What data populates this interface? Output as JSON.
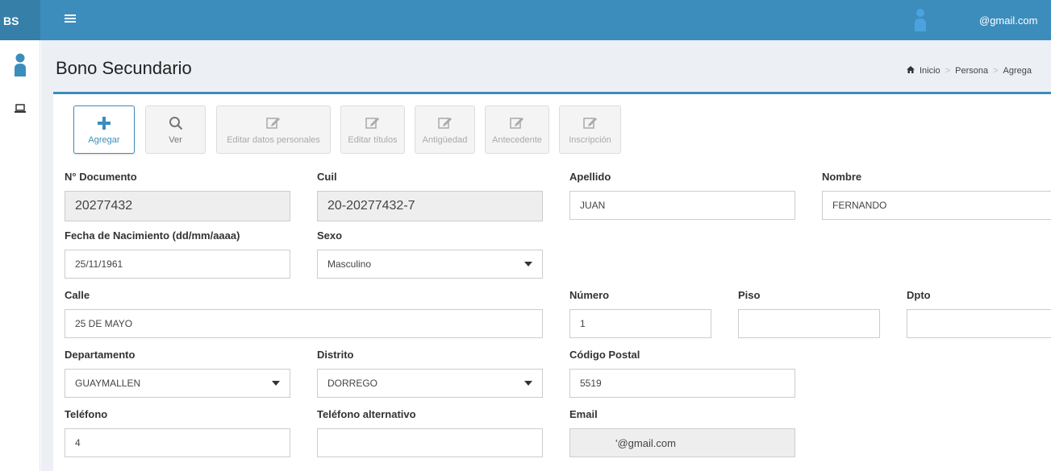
{
  "app": {
    "brand": "BS",
    "user_email": "@gmail.com"
  },
  "page": {
    "title": "Bono Secundario"
  },
  "breadcrumb": {
    "home": "Inicio",
    "item2": "Persona",
    "item3": "Agrega"
  },
  "toolbar": [
    {
      "label": "Agregar",
      "icon": "plus-icon"
    },
    {
      "label": "Ver",
      "icon": "search-icon"
    },
    {
      "label": "Editar datos personales",
      "icon": "edit-icon"
    },
    {
      "label": "Editar títulos",
      "icon": "edit-icon"
    },
    {
      "label": "Antigüedad",
      "icon": "edit-icon"
    },
    {
      "label": "Antecedente",
      "icon": "edit-icon"
    },
    {
      "label": "Inscripción",
      "icon": "edit-icon"
    }
  ],
  "form": {
    "documento": {
      "label": "N° Documento",
      "value": "20277432"
    },
    "cuil": {
      "label": "Cuil",
      "value": "20-20277432-7"
    },
    "apellido": {
      "label": "Apellido",
      "value": "JUAN"
    },
    "nombre": {
      "label": "Nombre",
      "value": "FERNANDO"
    },
    "fecha_nacimiento": {
      "label": "Fecha de Nacimiento (dd/mm/aaaa)",
      "value": "25/11/1961"
    },
    "sexo": {
      "label": "Sexo",
      "value": "Masculino"
    },
    "calle": {
      "label": "Calle",
      "value": "25 DE MAYO"
    },
    "numero": {
      "label": "Número",
      "value": "1"
    },
    "piso": {
      "label": "Piso",
      "value": ""
    },
    "dpto": {
      "label": "Dpto",
      "value": ""
    },
    "departamento": {
      "label": "Departamento",
      "value": "GUAYMALLEN"
    },
    "distrito": {
      "label": "Distrito",
      "value": "DORREGO"
    },
    "codigo_postal": {
      "label": "Código Postal",
      "value": "5519"
    },
    "telefono": {
      "label": "Teléfono",
      "value": "4"
    },
    "telefono_alt": {
      "label": "Teléfono alternativo",
      "value": ""
    },
    "email": {
      "label": "Email",
      "value": "'@gmail.com"
    }
  },
  "colors": {
    "primary": "#3c8dbc",
    "brand_bg": "#367fa9",
    "content_bg": "#ecf0f5"
  }
}
